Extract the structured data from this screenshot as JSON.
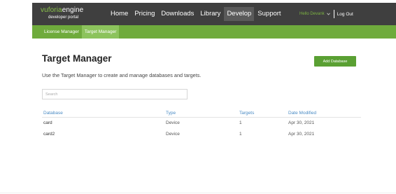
{
  "header": {
    "logo": {
      "brand": "vuforia",
      "product": "engine",
      "subtitle": "developer portal"
    },
    "nav": [
      {
        "label": "Home",
        "active": false
      },
      {
        "label": "Pricing",
        "active": false
      },
      {
        "label": "Downloads",
        "active": false
      },
      {
        "label": "Library",
        "active": false
      },
      {
        "label": "Develop",
        "active": true
      },
      {
        "label": "Support",
        "active": false
      }
    ],
    "user_greeting": "Hello Devank",
    "logout_label": "Log Out"
  },
  "subnav": [
    {
      "label": "License Manager",
      "active": false
    },
    {
      "label": "Target Manager",
      "active": true
    }
  ],
  "main": {
    "title": "Target Manager",
    "add_button_label": "Add Database",
    "description": "Use the Target Manager to create and manage databases and targets.",
    "search_placeholder": "Search",
    "columns": [
      "Database",
      "Type",
      "Targets",
      "Date Modified"
    ],
    "rows": [
      {
        "database": "card",
        "type": "Device",
        "targets": "1",
        "date": "Apr 30, 2021"
      },
      {
        "database": "card2",
        "type": "Device",
        "targets": "1",
        "date": "Apr 30, 2021"
      }
    ]
  },
  "colors": {
    "topbar": "#3f3f3f",
    "subbar": "#6fab3c",
    "accent": "#5aa033",
    "link": "#4a8bc4"
  }
}
